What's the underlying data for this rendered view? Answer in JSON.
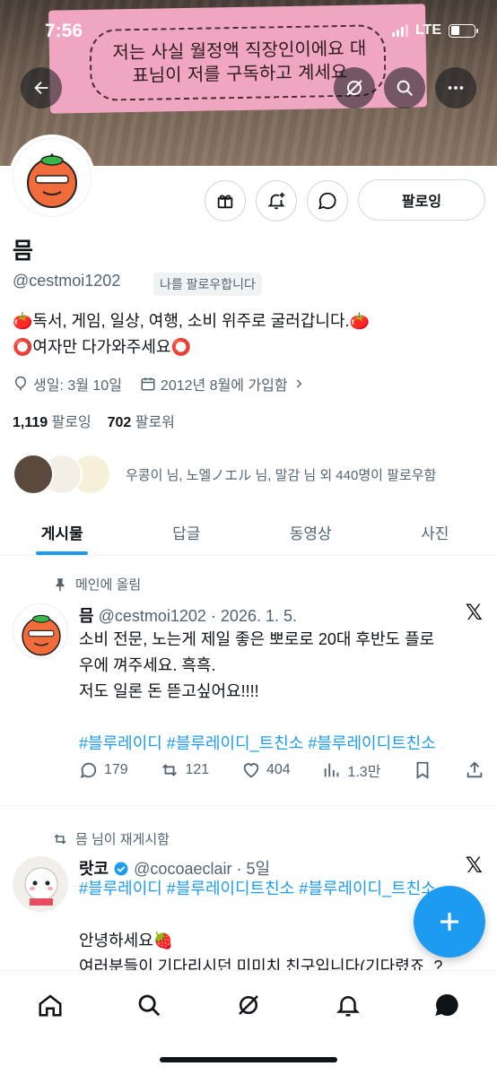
{
  "status": {
    "time": "7:56",
    "network": "LTE"
  },
  "banner": {
    "note_text": "저는 사실 월정액 직장인이에요 대표님이 저를 구독하고 계세요"
  },
  "profile": {
    "name": "믐",
    "handle": "@cestmoi1202",
    "follows_you": "나를 팔로우합니다",
    "follow_button": "팔로잉",
    "bio_line1": "🍅독서, 게임, 일상, 여행, 소비 위주로 굴러갑니다.🍅",
    "bio_line2": "⭕여자만 다가와주세요⭕",
    "birthday": "생일: 3월 10일",
    "joined": "2012년 8월에 가입함",
    "following_count": "1,119",
    "following_label": "팔로잉",
    "followers_count": "702",
    "followers_label": "팔로워",
    "known_followers": "우콩이 님, 노엘ノエル 님, 말감 님 외 440명이 팔로우함"
  },
  "tabs": [
    {
      "label": "게시물",
      "active": true
    },
    {
      "label": "답글",
      "active": false
    },
    {
      "label": "동영상",
      "active": false
    },
    {
      "label": "사진",
      "active": false
    }
  ],
  "posts": [
    {
      "context": "메인에 올림",
      "name": "믐",
      "meta": "@cestmoi1202 · 2026. 1. 5.",
      "line1": "소비 전문, 노는게 제일 좋은 뽀로로 20대 후반도 플로",
      "line2": "우에 껴주세요. 흑흑.",
      "line3": "저도 일론 돈 뜯고싶어요!!!!",
      "hashtags": "#블루레이디 #블루레이디_트친소 #블루레이디트친소",
      "replies": "179",
      "reposts": "121",
      "likes": "404",
      "views": "1.3만"
    },
    {
      "context": "믐 님이 재게시함",
      "name": "랏코",
      "meta": "@cocoaeclair · 5일",
      "hashtags": "#블루레이디 #블루레이디트친소 #블루레이디_트친소",
      "line1": "안녕하세요🍓",
      "line2": "여러분들이 기다리시던 미미치 친구입니다(기다렸죠..?"
    }
  ],
  "colors": {
    "accent": "#1d9bf0",
    "text": "#0f1419",
    "muted": "#536471"
  }
}
